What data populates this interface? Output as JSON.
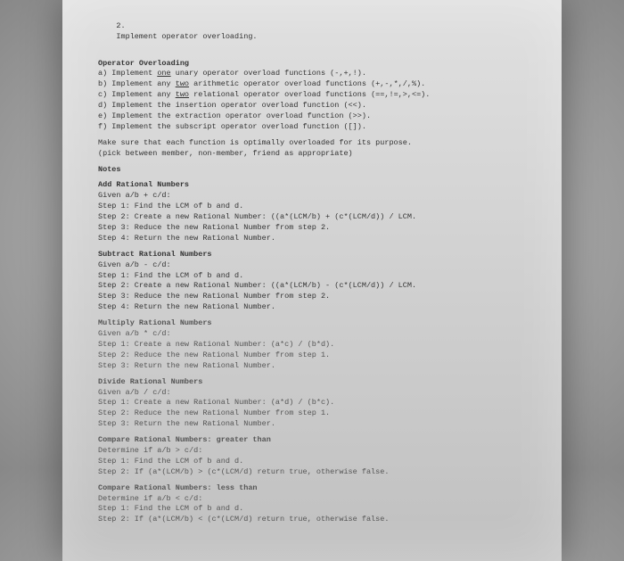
{
  "header": {
    "num": "2.",
    "title": "Implement operator overloading."
  },
  "section_title": "Operator Overloading",
  "items": {
    "a": "a) Implement ",
    "a_u": "one",
    "a2": " unary operator overload functions (-,+,!).",
    "b": "b) Implement any ",
    "b_u": "two",
    "b2": " arithmetic operator overload functions (+,-,*,/,%).",
    "c": "c) Implement any ",
    "c_u": "two",
    "c2": " relational operator overload functions (==,!=,>,<=).",
    "d": "d) Implement the insertion operator overload function (<<).",
    "e": "e) Implement the extraction operator overload function (>>).",
    "f": "f) Implement the subscript operator overload function ([])."
  },
  "note1": "Make sure that each function is optimally overloaded for its purpose.",
  "note2": "(pick between member, non-member, friend as appropriate)",
  "notes_label": "Notes",
  "add": {
    "title": "Add Rational Numbers",
    "given": "Given a/b + c/d:",
    "s1": "Step 1: Find the LCM of b and d.",
    "s2": "Step 2: Create a new Rational Number: ((a*(LCM/b) + (c*(LCM/d)) / LCM.",
    "s3": "Step 3: Reduce the new Rational Number from step 2.",
    "s4": "Step 4: Return the new Rational Number."
  },
  "sub": {
    "title": "Subtract Rational Numbers",
    "given": "Given a/b - c/d:",
    "s1": "Step 1: Find the LCM of b and d.",
    "s2": "Step 2: Create a new Rational Number: ((a*(LCM/b) - (c*(LCM/d)) / LCM.",
    "s3": "Step 3: Reduce the new Rational Number from step 2.",
    "s4": "Step 4: Return the new Rational Number."
  },
  "mul": {
    "title": "Multiply Rational Numbers",
    "given": "Given a/b * c/d:",
    "s1": "Step 1: Create a new Rational Number: (a*c) / (b*d).",
    "s2": "Step 2: Reduce the new Rational Number from step 1.",
    "s3": "Step 3: Return the new Rational Number."
  },
  "div": {
    "title": "Divide Rational Numbers",
    "given": "Given a/b / c/d:",
    "s1": "Step 1: Create a new Rational Number: (a*d) / (b*c).",
    "s2": "Step 2: Reduce the new Rational Number from step 1.",
    "s3": "Step 3: Return the new Rational Number."
  },
  "gt": {
    "title": "Compare Rational Numbers: greater than",
    "given": "Determine if a/b > c/d:",
    "s1": "Step 1: Find the LCM of b and d.",
    "s2": "Step 2: If (a*(LCM/b) > (c*(LCM/d) return true, otherwise false."
  },
  "lt": {
    "title": "Compare Rational Numbers: less than",
    "given": "Determine if a/b < c/d:",
    "s1": "Step 1: Find the LCM of b and d.",
    "s2": "Step 2: If (a*(LCM/b) < (c*(LCM/d) return true, otherwise false."
  }
}
